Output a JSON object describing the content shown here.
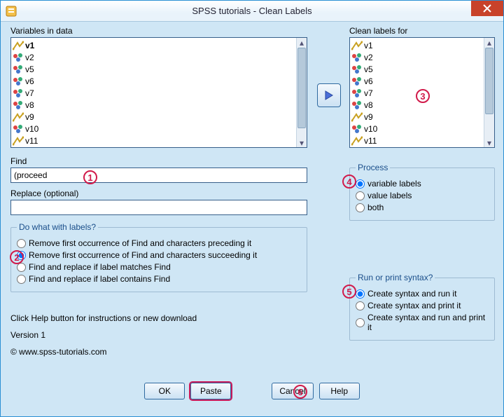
{
  "window": {
    "title": "SPSS tutorials - Clean Labels"
  },
  "left": {
    "label": "Variables in data",
    "items": [
      "v1",
      "v2",
      "v5",
      "v6",
      "v7",
      "v8",
      "v9",
      "v10",
      "v11"
    ],
    "types": [
      "scale",
      "nominal",
      "nominal",
      "nominal",
      "nominal",
      "nominal",
      "scale",
      "nominal",
      "scale"
    ]
  },
  "right": {
    "label": "Clean labels for",
    "items": [
      "v1",
      "v2",
      "v5",
      "v6",
      "v7",
      "v8",
      "v9",
      "v10",
      "v11"
    ],
    "types": [
      "scale",
      "nominal",
      "nominal",
      "nominal",
      "nominal",
      "nominal",
      "scale",
      "nominal",
      "scale"
    ]
  },
  "find": {
    "label": "Find",
    "value": "(proceed"
  },
  "replace": {
    "label": "Replace (optional)",
    "value": ""
  },
  "dowhat": {
    "legend": "Do what with labels?",
    "options": [
      "Remove first occurrence of Find and characters preceding it",
      "Remove first occurrence of Find and characters succeeding it",
      "Find and replace if label matches Find",
      "Find and replace if label contains Find"
    ],
    "selected": 1
  },
  "process": {
    "legend": "Process",
    "options": [
      "variable labels",
      "value labels",
      "both"
    ],
    "selected": 0
  },
  "runprint": {
    "legend": "Run or print syntax?",
    "options": [
      "Create syntax and run it",
      "Create syntax and print it",
      "Create syntax and run and print it"
    ],
    "selected": 0
  },
  "info": {
    "line1": "Click Help button for instructions or new download",
    "line2": "Version 1",
    "line3": "© www.spss-tutorials.com"
  },
  "buttons": {
    "ok": "OK",
    "paste": "Paste",
    "cancel": "Cancel",
    "help": "Help"
  },
  "callouts": {
    "c1": "1",
    "c2": "2",
    "c3": "3",
    "c4": "4",
    "c5": "5",
    "c6": "6"
  }
}
